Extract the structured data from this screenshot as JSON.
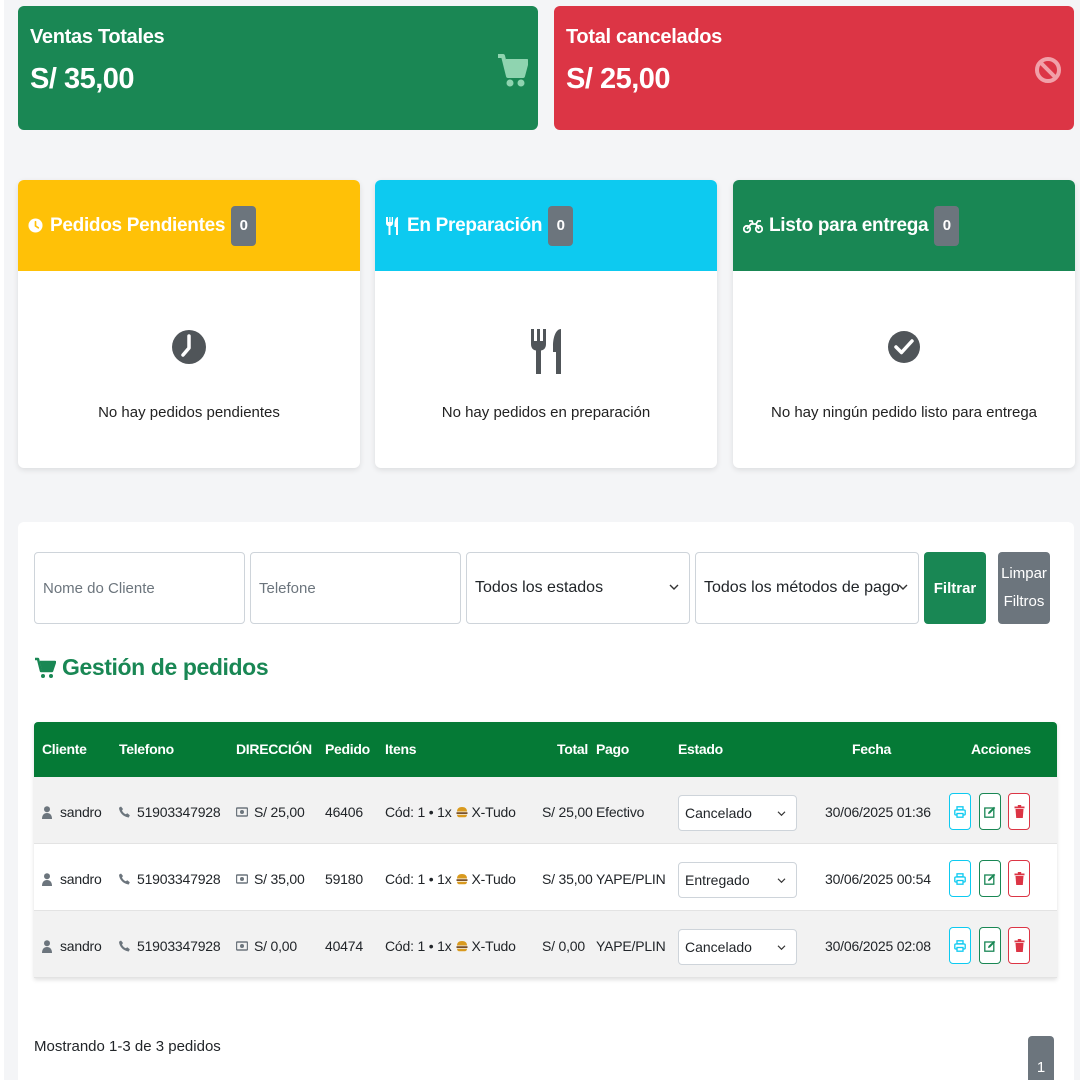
{
  "summary": {
    "sales": {
      "title": "Ventas Totales",
      "value": "S/ 35,00",
      "icon": "cart-icon",
      "color": "#1a8754"
    },
    "cancelled": {
      "title": "Total cancelados",
      "value": "S/ 25,00",
      "icon": "ban-icon",
      "color": "#dc3545"
    }
  },
  "status_cards": {
    "pending": {
      "title": "Pedidos Pendientes",
      "count": "0",
      "empty": "No hay pedidos pendientes",
      "color": "#ffc107",
      "icon": "clock-icon"
    },
    "preparation": {
      "title": "En Preparación",
      "count": "0",
      "empty": "No hay pedidos en preparación",
      "color": "#0dcaf0",
      "icon": "utensils-icon"
    },
    "ready": {
      "title": "Listo para entrega",
      "count": "0",
      "empty": "No hay ningún pedido listo para entrega",
      "color": "#198754",
      "icon": "motorcycle-icon"
    }
  },
  "filters": {
    "client_placeholder": "Nome do Cliente",
    "phone_placeholder": "Telefone",
    "state_selected": "Todos los estados",
    "payment_selected": "Todos los métodos de pago",
    "filter_label": "Filtrar",
    "clear_label_1": "Limpar",
    "clear_label_2": "Filtros"
  },
  "section_title": "Gestión de pedidos",
  "table": {
    "headers": {
      "client": "Cliente",
      "phone": "Telefono",
      "address": "DIRECCIÓN",
      "order": "Pedido",
      "items": "Itens",
      "total": "Total",
      "payment": "Pago",
      "state": "Estado",
      "date": "Fecha",
      "actions": "Acciones"
    },
    "rows": [
      {
        "client": "sandro",
        "phone": "51903347928",
        "address": "S/ 25,00",
        "order": "46406",
        "items": "Cód: 1 • 1x",
        "item_name": "X-Tudo",
        "total": "S/ 25,00",
        "payment": "Efectivo",
        "state": "Cancelado",
        "date": "30/06/2025 01:36"
      },
      {
        "client": "sandro",
        "phone": "51903347928",
        "address": "S/ 35,00",
        "order": "59180",
        "items": "Cód: 1 • 1x",
        "item_name": "X-Tudo",
        "total": "S/ 35,00",
        "payment": "YAPE/PLIN",
        "state": "Entregado",
        "date": "30/06/2025 00:54"
      },
      {
        "client": "sandro",
        "phone": "51903347928",
        "address": "S/ 0,00",
        "order": "40474",
        "items": "Cód: 1 • 1x",
        "item_name": "X-Tudo",
        "total": "S/ 0,00",
        "payment": "YAPE/PLIN",
        "state": "Cancelado",
        "date": "30/06/2025 02:08"
      }
    ]
  },
  "footer": {
    "showing": "Mostrando 1-3 de 3 pedidos",
    "page": "1"
  }
}
